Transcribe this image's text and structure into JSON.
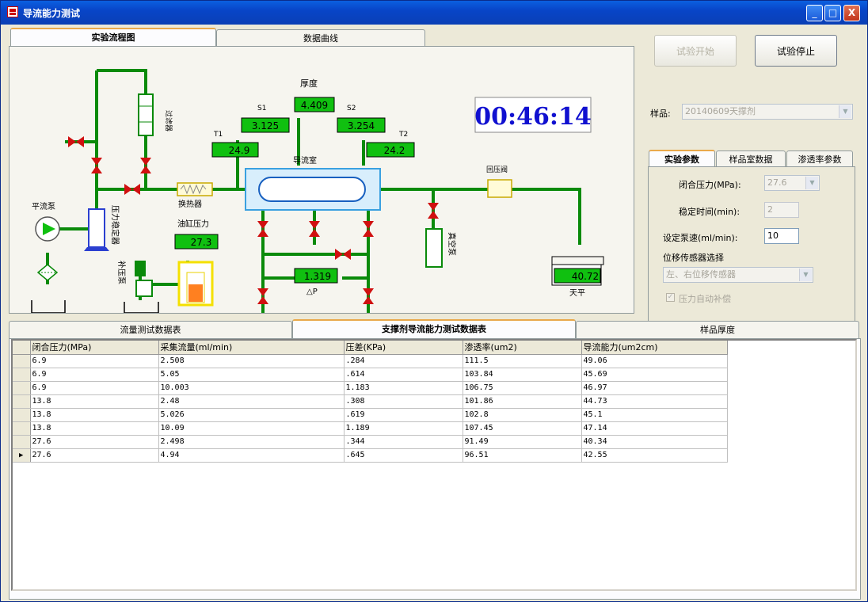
{
  "window": {
    "title": "导流能力测试",
    "btn_min": "_",
    "btn_max": "□",
    "btn_close": "X"
  },
  "tabs_top": [
    {
      "label": "实验流程图",
      "active": true
    },
    {
      "label": "数据曲线",
      "active": false
    }
  ],
  "diagram": {
    "thickness_label": "厚度",
    "thickness_value": "4.409",
    "s1_label": "S1",
    "s1_value": "3.125",
    "s2_label": "S2",
    "s2_value": "3.254",
    "t1_label": "T1",
    "t1_value": "24.9",
    "t2_label": "T2",
    "t2_value": "24.2",
    "chamber_label": "导流室",
    "pump_label": "平流泵",
    "stabilizer_label": "压力稳定器",
    "heat_exchanger_label": "换热器",
    "filter_label": "过滤器",
    "cylinder_pressure_label": "油缸压力",
    "cylinder_pressure_value": "27.3",
    "booster_pump_label": "补压泵",
    "dp_value": "1.319",
    "dp_label": "△P",
    "vacuum_label": "真空泵",
    "back_valve_label": "回压阀",
    "balance_label": "天平",
    "balance_value": "40.72",
    "timer": "00:46:14"
  },
  "controls": {
    "start_button": "试验开始",
    "stop_button": "试验停止",
    "sample_label": "样品:",
    "sample_value": "20140609天撑剂"
  },
  "param_tabs": [
    {
      "label": "实验参数",
      "active": true
    },
    {
      "label": "样品室数据",
      "active": false
    },
    {
      "label": "渗透率参数",
      "active": false
    }
  ],
  "params": {
    "closure_pressure_label": "闭合压力(MPa):",
    "closure_pressure_value": "27.6",
    "stable_time_label": "稳定时间(min):",
    "stable_time_value": "2",
    "pump_rate_label": "设定泵速(ml/min):",
    "pump_rate_value": "10",
    "sensor_label": "位移传感器选择",
    "sensor_value": "左、右位移传感器",
    "auto_comp_label": "压力自动补偿",
    "auto_comp_check": "✓"
  },
  "tabs_bottom": [
    {
      "label": "流量测试数据表",
      "active": false
    },
    {
      "label": "支撑剂导流能力测试数据表",
      "active": true
    },
    {
      "label": "样品厚度",
      "active": false
    }
  ],
  "table": {
    "headers": [
      "闭合压力(MPa)",
      "采集流量(ml/min)",
      "压差(KPa)",
      "渗透率(um2)",
      "导流能力(um2cm)"
    ],
    "current_row_marker": "▶",
    "rows": [
      [
        "6.9",
        "2.508",
        ".284",
        "111.5",
        "49.06"
      ],
      [
        "6.9",
        "5.05",
        ".614",
        "103.84",
        "45.69"
      ],
      [
        "6.9",
        "10.003",
        "1.183",
        "106.75",
        "46.97"
      ],
      [
        "13.8",
        "2.48",
        ".308",
        "101.86",
        "44.73"
      ],
      [
        "13.8",
        "5.026",
        ".619",
        "102.8",
        "45.1"
      ],
      [
        "13.8",
        "10.09",
        "1.189",
        "107.45",
        "47.14"
      ],
      [
        "27.6",
        "2.498",
        ".344",
        "91.49",
        "40.34"
      ],
      [
        "27.6",
        "4.94",
        ".645",
        "96.51",
        "42.55"
      ]
    ]
  },
  "colors": {
    "pipe": "#0a8a0a",
    "valve": "#d01010",
    "display_bg": "#10c010",
    "timer_text": "#1010d0"
  }
}
